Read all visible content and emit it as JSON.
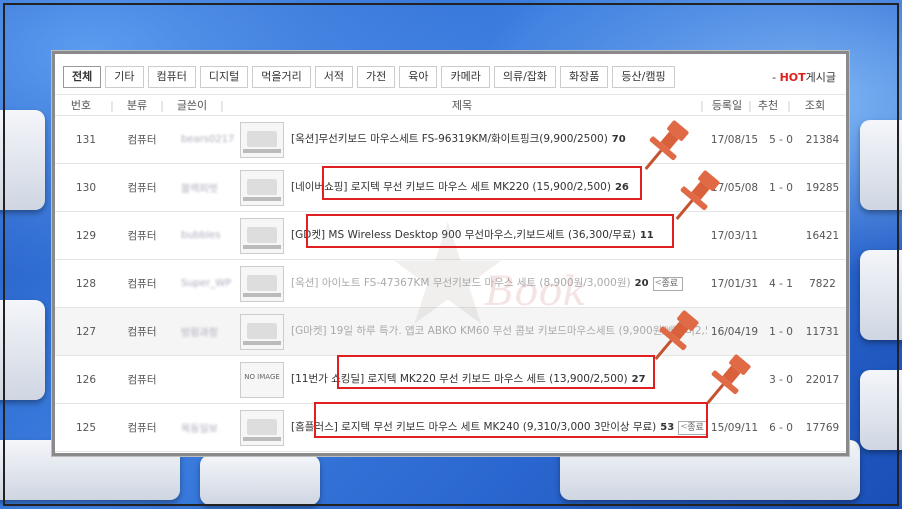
{
  "tabs": [
    "전체",
    "기타",
    "컴퓨터",
    "디지털",
    "먹을거리",
    "서적",
    "가전",
    "육아",
    "카메라",
    "의류/잡화",
    "화장품",
    "등산/캠핑"
  ],
  "hot": {
    "label": "HOT",
    "suffix": "게시글"
  },
  "columns": {
    "no": "번호",
    "cat": "분류",
    "user": "글쓴이",
    "title": "제목",
    "date": "등록일",
    "rec": "추천",
    "views": "조회"
  },
  "rows": [
    {
      "no": "131",
      "cat": "컴퓨터",
      "user": "bears0217",
      "title": "[옥션]무선키보드 마우스세트 FS-96319KM/화이트핑크(9,900/2500)",
      "cnt": "70",
      "tag": "",
      "date": "17/08/15",
      "rec": "5 - 0",
      "views": "21384",
      "faded": false
    },
    {
      "no": "130",
      "cat": "컴퓨터",
      "user": "블랙피벗",
      "title": "[네이버쇼핑] 로지텍 무선 키보드 마우스 세트 MK220 (15,900/2,500)",
      "cnt": "26",
      "tag": "",
      "date": "17/05/08",
      "rec": "1 - 0",
      "views": "19285",
      "faded": false
    },
    {
      "no": "129",
      "cat": "컴퓨터",
      "user": "bubbles",
      "title": "[GD켓] MS Wireless Desktop 900 무선마우스,키보드세트 (36,300/무료)",
      "cnt": "11",
      "tag": "",
      "date": "17/03/11",
      "rec": "",
      "views": "16421",
      "faded": false
    },
    {
      "no": "128",
      "cat": "컴퓨터",
      "user": "Super_WP",
      "title": "[옥션] 아이노트 FS-47367KM 무선키보드 마우스 세트 (8,900원/3,000원)",
      "cnt": "20",
      "tag": "종료",
      "date": "17/01/31",
      "rec": "4 - 1",
      "views": "7822",
      "faded": true
    },
    {
      "no": "127",
      "cat": "컴퓨터",
      "user": "방황과정",
      "title": "[G마켓] 19일 하루 특가. 앱코 ABKO KM60 무선 콤보 키보드마우스세트 (9,900원/배송비2,500원)",
      "cnt": "15",
      "tag": "종료",
      "date": "16/04/19",
      "rec": "1 - 0",
      "views": "11731",
      "faded": true
    },
    {
      "no": "126",
      "cat": "컴퓨터",
      "user": "",
      "title": "[11번가 쇼킹딜] 로지텍 MK220 무선 키보드 마우스 세트 (13,900/2,500)",
      "cnt": "27",
      "tag": "",
      "date": "",
      "rec": "3 - 0",
      "views": "22017",
      "faded": false
    },
    {
      "no": "125",
      "cat": "컴퓨터",
      "user": "목동일보",
      "title": "[홈플러스] 로지텍 무선 키보드 마우스 세트 MK240 (9,310/3,000 3만이상 무료)",
      "cnt": "53",
      "tag": "종료",
      "date": "15/09/11",
      "rec": "6 - 0",
      "views": "17769",
      "faded": false
    }
  ],
  "thumb_noimage": "NO IMAGE",
  "watermark": "Book",
  "colors": {
    "hot": "#e01e1e",
    "box": "#e02020",
    "pin": "#e06a45",
    "bg": "#2a64c8"
  }
}
